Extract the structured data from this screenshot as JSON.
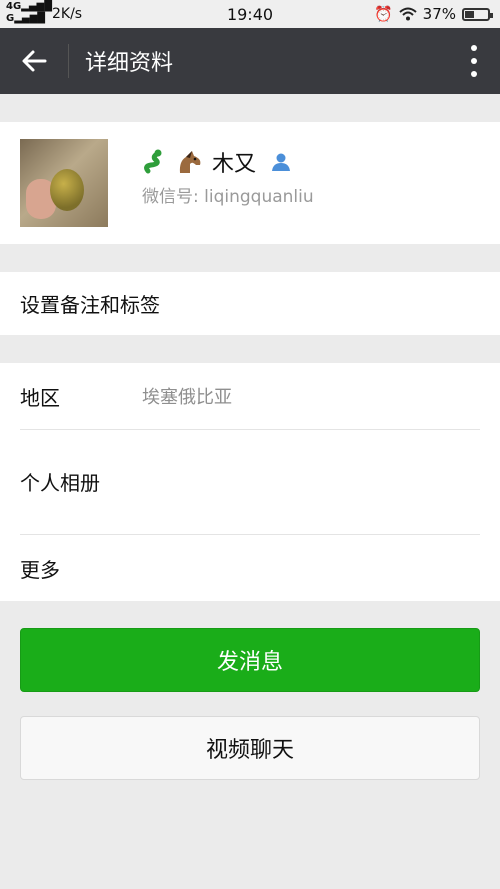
{
  "status_bar": {
    "signal_top": "4G",
    "signal_bottom": "G",
    "net_speed": "2K/s",
    "time": "19:40",
    "battery": "37%",
    "battery_level": 0.37
  },
  "app_bar": {
    "title": "详细资料",
    "back_icon": "arrow-left-icon",
    "more_icon": "more-vertical-icon"
  },
  "profile": {
    "nickname": "木又",
    "wechat_id": "微信号: liqingquanliu",
    "emoji_icons": [
      "snake-emoji-icon",
      "horse-emoji-icon"
    ],
    "gender_icon": "person-icon"
  },
  "remark": {
    "label": "设置备注和标签"
  },
  "info": {
    "region_label": "地区",
    "region_value": "埃塞俄比亚",
    "album_label": "个人相册",
    "more_label": "更多"
  },
  "actions": {
    "send_message": "发消息",
    "video_call": "视频聊天"
  },
  "colors": {
    "appbar": "#393a3f",
    "primary": "#1aad19"
  }
}
